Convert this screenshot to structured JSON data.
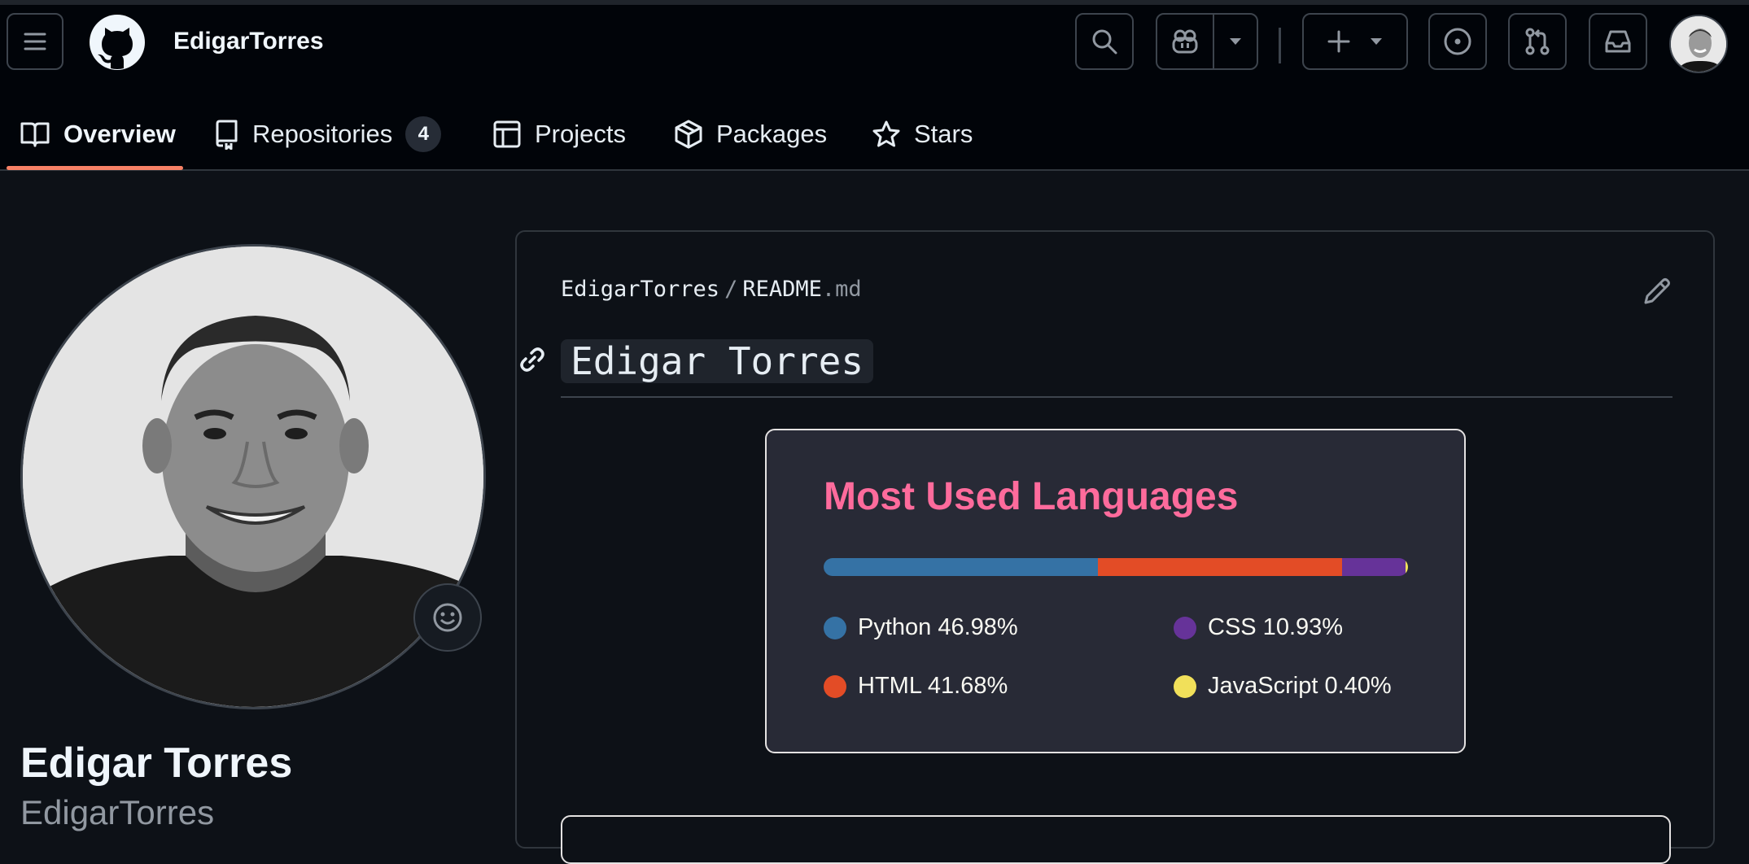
{
  "header": {
    "username": "EdigarTorres"
  },
  "tabs": [
    {
      "label": "Overview"
    },
    {
      "label": "Repositories",
      "count": "4"
    },
    {
      "label": "Projects"
    },
    {
      "label": "Packages"
    },
    {
      "label": "Stars"
    }
  ],
  "profile": {
    "full_name": "Edigar Torres",
    "login": "EdigarTorres"
  },
  "readme": {
    "owner": "EdigarTorres",
    "separator": "/",
    "file": "README",
    "ext": ".md",
    "heading": "Edigar Torres"
  },
  "chart_data": {
    "type": "bar",
    "title": "Most Used Languages",
    "series": [
      {
        "name": "Python",
        "label": "Python 46.98%",
        "value": 46.98,
        "color": "#3572A5"
      },
      {
        "name": "HTML",
        "label": "HTML 41.68%",
        "value": 41.68,
        "color": "#e34c26"
      },
      {
        "name": "CSS",
        "label": "CSS 10.93%",
        "value": 10.93,
        "color": "#663399"
      },
      {
        "name": "JavaScript",
        "label": "JavaScript 0.40%",
        "value": 0.4,
        "color": "#f1e05a"
      }
    ]
  },
  "colors": {
    "accent_tab_underline": "#f78166",
    "card_title": "#fe6b9c",
    "card_bg": "#282a36"
  }
}
